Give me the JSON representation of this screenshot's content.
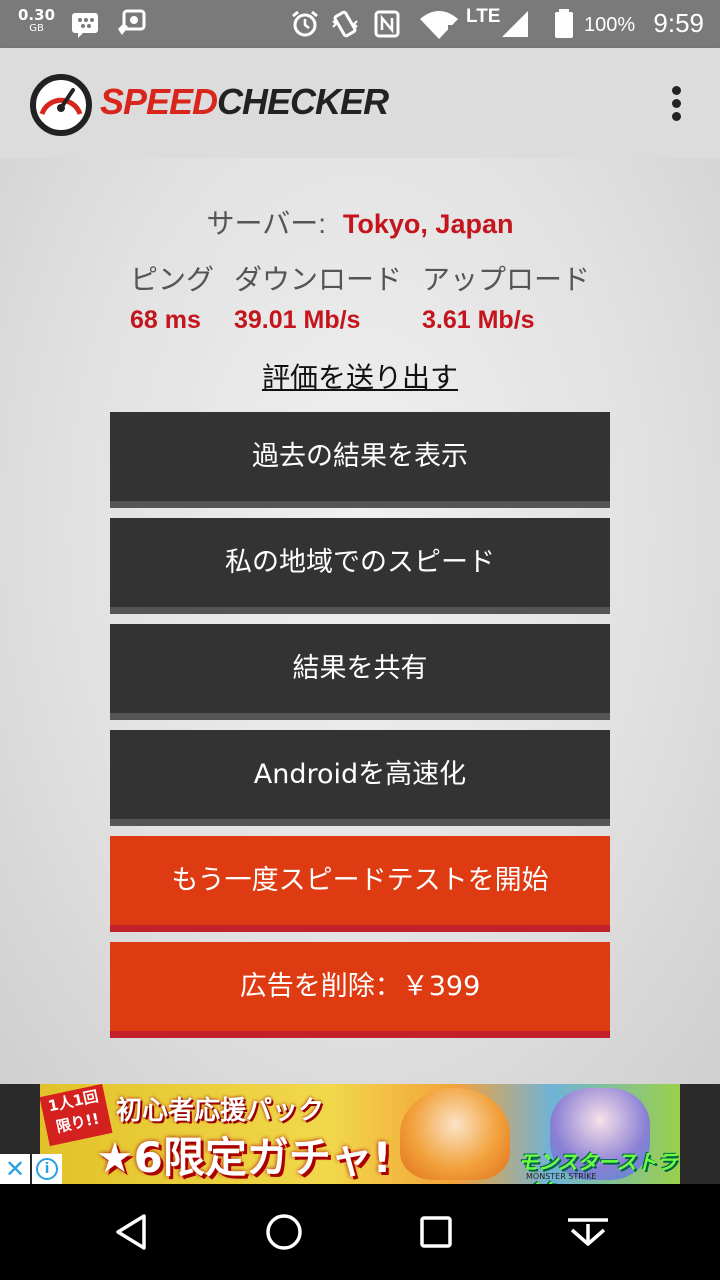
{
  "status_bar": {
    "data_usage": "0.30",
    "data_unit": "GB",
    "network": "LTE",
    "battery": "100%",
    "time": "9:59",
    "icons": [
      "bbm-icon",
      "screenshot-icon",
      "alarm-icon",
      "vibrate-icon",
      "nfc-icon",
      "wifi-icon",
      "signal-icon",
      "battery-icon"
    ]
  },
  "app_bar": {
    "logo_part1": "SPEED",
    "logo_part2": "CHECKER",
    "menu_icon": "more-vert-icon"
  },
  "results": {
    "server_label": "サーバー:",
    "server_value": "Tokyo, Japan",
    "ping_label": "ピング",
    "ping_value": "68 ms",
    "download_label": "ダウンロード",
    "download_value": "39.01 Mb/s",
    "upload_label": "アップロード",
    "upload_value": "3.61 Mb/s"
  },
  "rate_link": "評価を送り出す",
  "buttons": [
    {
      "label": "過去の結果を表示",
      "style": "dark"
    },
    {
      "label": "私の地域でのスピード",
      "style": "dark"
    },
    {
      "label": "結果を共有",
      "style": "dark"
    },
    {
      "label": "Androidを高速化",
      "style": "dark"
    },
    {
      "label": "もう一度スピードテストを開始",
      "style": "red"
    },
    {
      "label": "広告を削除：￥399",
      "style": "red"
    }
  ],
  "ad": {
    "tag": "1人1回限り!!",
    "line1": "初心者応援パック",
    "line2": "★6限定ガチャ!",
    "brand": "モンスターストライク",
    "brand_sub": "MONSTER STRIKE",
    "close_icon": "close-icon",
    "info_icon": "info-icon"
  },
  "colors": {
    "accent_red": "#c4141c",
    "button_dark": "#333333",
    "button_red": "#de3b12"
  }
}
